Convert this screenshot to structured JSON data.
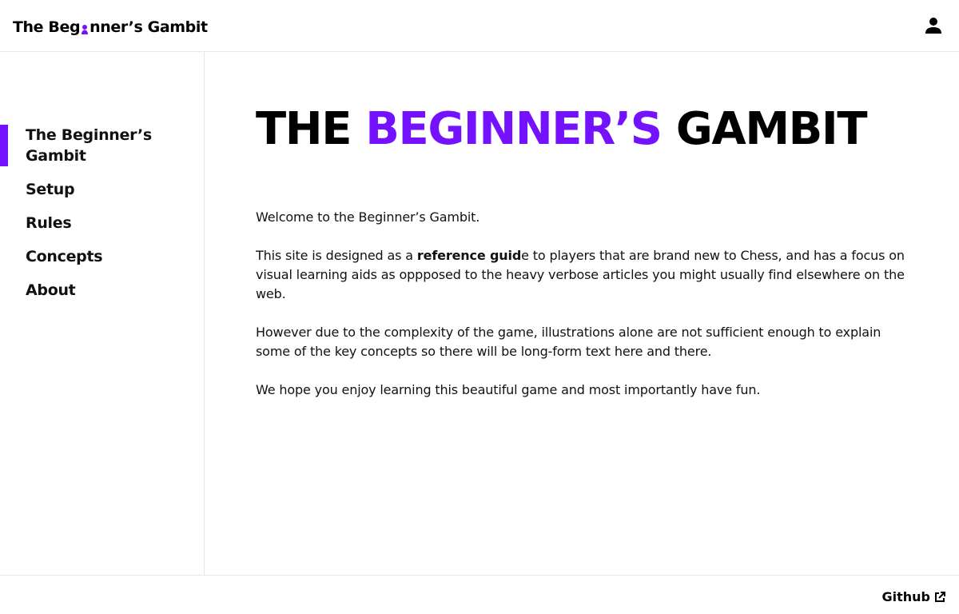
{
  "header": {
    "logo_part1": "The Beg",
    "logo_part2": "nner’s Gambit",
    "logo_pawn_icon": "pawn-icon",
    "user_icon": "user-icon"
  },
  "sidebar": {
    "items": [
      {
        "label": "The Beginner’s Gambit",
        "active": true
      },
      {
        "label": "Setup",
        "active": false
      },
      {
        "label": "Rules",
        "active": false
      },
      {
        "label": "Concepts",
        "active": false
      },
      {
        "label": "About",
        "active": false
      }
    ]
  },
  "main": {
    "title_word1": "THE",
    "title_word2": "BEGINNER’S",
    "title_word3": "GAMBIT",
    "p1": "Welcome to the Beginner’s Gambit.",
    "p2_before": "This site is designed as a ",
    "p2_bold": "reference guid",
    "p2_after": "e to players that are brand new to Chess, and has a focus on visual learning aids as oppposed to the heavy verbose articles you might usually find elsewhere on the web.",
    "p3": "However due to the complexity of the game, illustrations alone are not sufficient enough to explain some of the key concepts so there will be long-form text here and there.",
    "p4": "We hope you enjoy learning this beautiful game and most importantly have fun."
  },
  "footer": {
    "github_label": "Github",
    "github_icon": "external-link-icon"
  },
  "colors": {
    "accent": "#7411ff",
    "text": "#000000",
    "border": "#e6e6e6",
    "background": "#ffffff"
  }
}
